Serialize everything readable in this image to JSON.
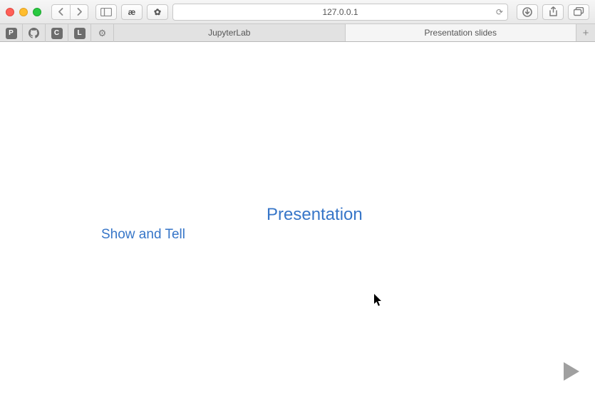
{
  "browser": {
    "address": "127.0.0.1",
    "extensions": {
      "a": "æ",
      "b": "✿"
    }
  },
  "favicons": {
    "p": "P",
    "c": "C",
    "l": "L"
  },
  "tabs": [
    {
      "label": "JupyterLab",
      "active": false
    },
    {
      "label": "Presentation slides",
      "active": true
    }
  ],
  "slide": {
    "title": "Presentation",
    "subtitle": "Show and Tell"
  }
}
